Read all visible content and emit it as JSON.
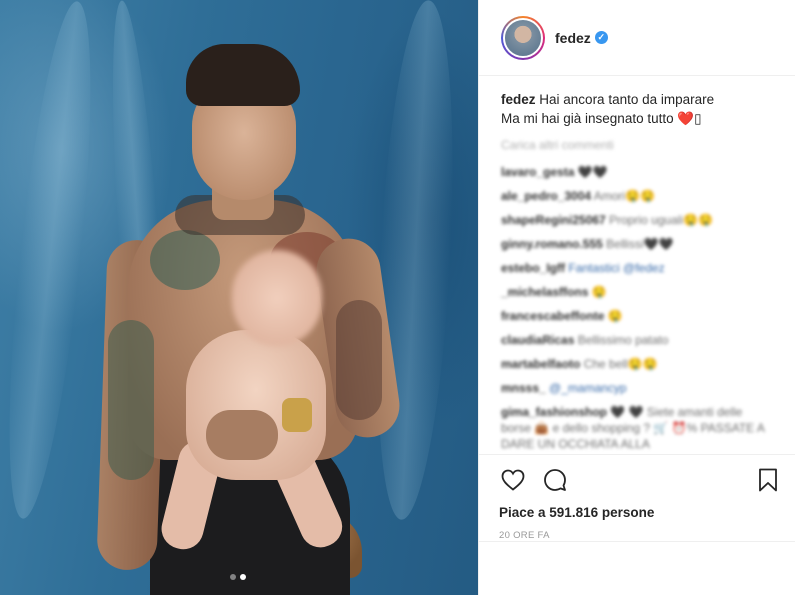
{
  "post": {
    "carousel": {
      "count": 2,
      "active_index": 1
    }
  },
  "header": {
    "username": "fedez",
    "verified": true
  },
  "caption": {
    "username": "fedez",
    "line1": "Hai ancora tanto da imparare",
    "line2": "Ma mi hai già insegnato tutto ❤️▯"
  },
  "comments": {
    "load_more_label": "Carica altri commenti",
    "items": [
      {
        "username": "lavaro_gesta",
        "text": "🖤🖤"
      },
      {
        "username": "ale_pedro_3004",
        "text": "Amori🤤🤤"
      },
      {
        "username": "shapeRegini25067",
        "text": "Proprio uguali🤤🤤"
      },
      {
        "username": "ginny.romano.555",
        "text": "Bellissi🖤🖤"
      },
      {
        "username": "estebo_Igff",
        "text": "Fantastici @fedez"
      },
      {
        "username": "_michelasffons",
        "text": "🤤"
      },
      {
        "username": "francescabeffonte",
        "text": "🤤"
      },
      {
        "username": "claudiaRicas",
        "text": "Bellissimo patato"
      },
      {
        "username": "martabelfaoto",
        "text": "Che bell🤤🤤"
      },
      {
        "username": "mnsss_",
        "text": "@_mamancyp"
      },
      {
        "username": "gima_fashionshop",
        "text": "🖤 🖤 Siete amanti delle borse 👜 e dello shopping ? 🛒 ⏰% PASSATE A DARE UN OCCHIATA ALLA"
      }
    ]
  },
  "actions": {
    "like_icon": "heart-icon",
    "comment_icon": "comment-bubble-icon",
    "save_icon": "bookmark-icon",
    "likes_label": "Piace a 591.816 persone",
    "time_label": "20 ORE FA"
  },
  "colors": {
    "verified_blue": "#3897f0",
    "text_primary": "#262626",
    "text_secondary": "#999999",
    "divider": "#efefef"
  }
}
